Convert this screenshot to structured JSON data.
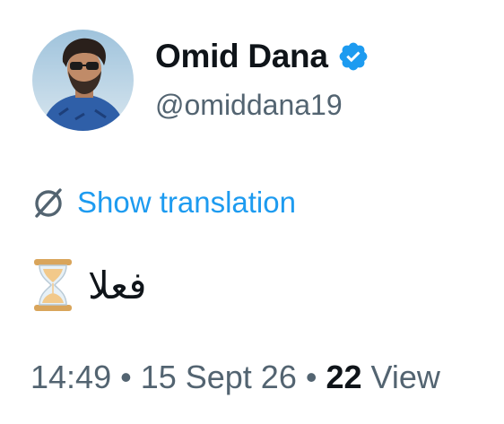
{
  "author": {
    "display_name": "Omid Dana",
    "handle": "@omiddana19",
    "verified": true,
    "avatar_icon": "profile-photo"
  },
  "translation": {
    "icon": "globe-slash-icon",
    "label": "Show translation"
  },
  "tweet": {
    "emoji_icon": "hourglass-icon",
    "text": "فعلا"
  },
  "meta": {
    "time": "14:49",
    "separator": "•",
    "date": "15 Sept 26",
    "views_count": "22",
    "views_label": "View"
  },
  "colors": {
    "link": "#1d9bf0",
    "verified_badge": "#1d9bf0",
    "secondary_text": "#536471",
    "primary_text": "#0f1419"
  }
}
